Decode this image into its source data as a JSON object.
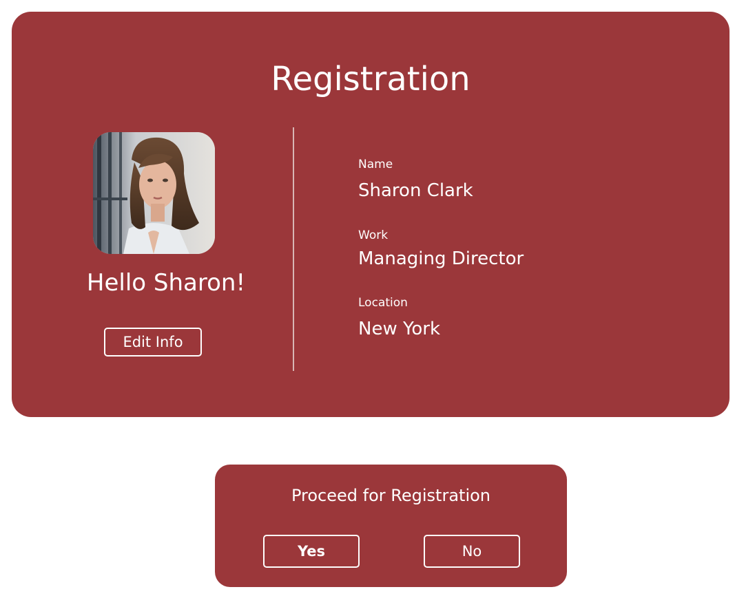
{
  "registration": {
    "title": "Registration",
    "greeting": "Hello Sharon!",
    "edit_button_label": "Edit Info",
    "fields": [
      {
        "label": "Name",
        "value": "Sharon Clark"
      },
      {
        "label": "Work",
        "value": "Managing Director"
      },
      {
        "label": "Location",
        "value": "New York"
      }
    ]
  },
  "dialog": {
    "title": "Proceed for Registration",
    "yes_label": "Yes",
    "no_label": "No"
  },
  "colors": {
    "card_background": "#9b373a",
    "text": "#ffffff",
    "divider": "#d8b7b5"
  }
}
